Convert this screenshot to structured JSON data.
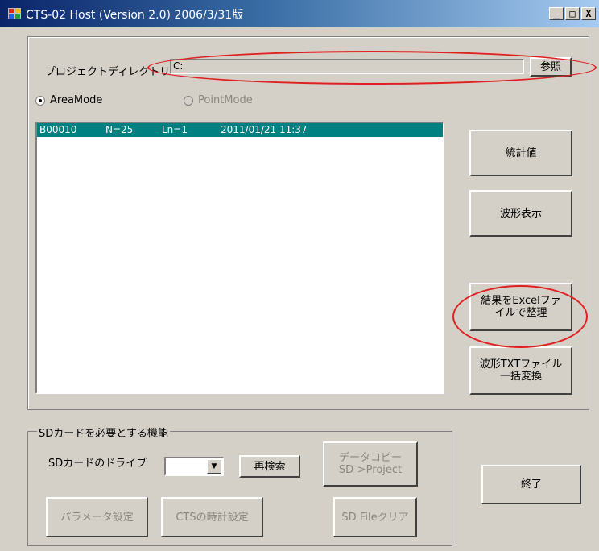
{
  "window": {
    "title": "CTS-02 Host (Version 2.0) 2006/3/31版",
    "minimize_label": "_",
    "maximize_label": "□",
    "close_label": "X"
  },
  "project": {
    "label": "プロジェクトディレクトリー",
    "path_value": "C:",
    "browse_label": "参照"
  },
  "mode": {
    "area_label": "AreaMode",
    "point_label": "PointMode",
    "selected": "AreaMode"
  },
  "list": {
    "rows": [
      {
        "id": "B00010",
        "n": "N=25",
        "ln": "Ln=1",
        "datetime": "2011/01/21 11:37"
      }
    ]
  },
  "buttons": {
    "stats": "統計値",
    "waveform": "波形表示",
    "excel_line1": "結果をExcelファ",
    "excel_line2": "イルで整理",
    "txt_line1": "波形TXTファイル",
    "txt_line2": "一括変換",
    "exit": "終了"
  },
  "sd": {
    "group_title": "SDカードを必要とする機能",
    "drive_label": "SDカードのドライブ",
    "drive_value": "",
    "rescan": "再検索",
    "copy_line1": "データコピー",
    "copy_line2": "SD->Project",
    "param": "パラメータ設定",
    "clock": "CTSの時計設定",
    "clear": "SD Fileクリア"
  },
  "colors": {
    "annotation": "#e02020",
    "selection": "#008080"
  }
}
